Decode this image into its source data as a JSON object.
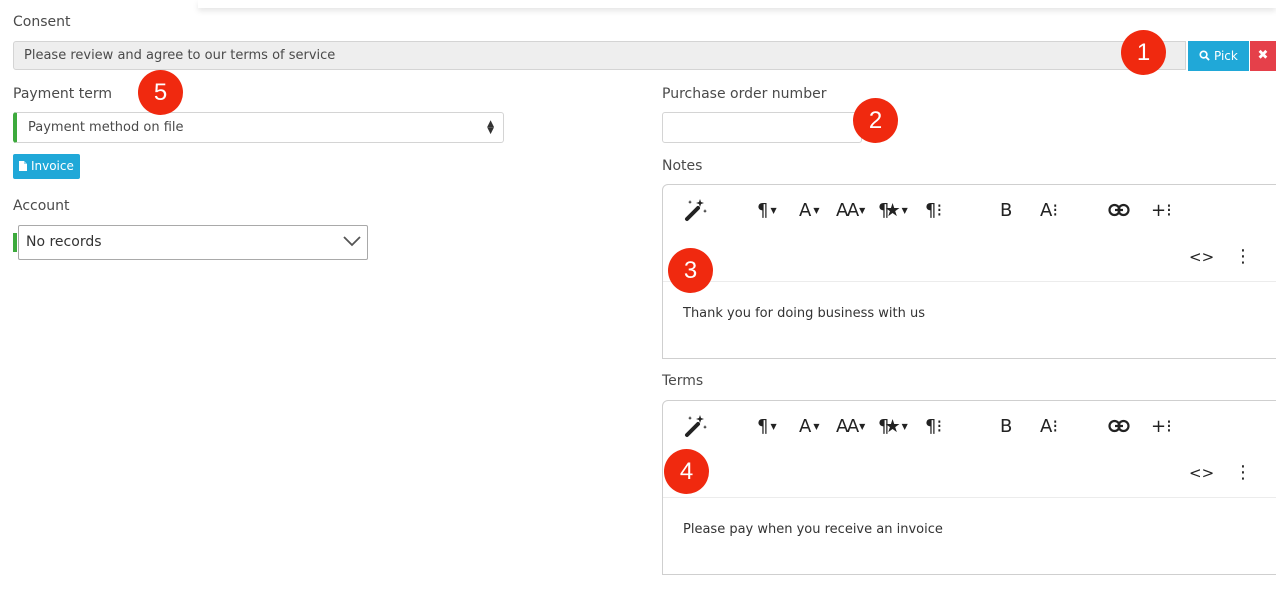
{
  "consent": {
    "label": "Consent",
    "value": "Please review and agree to our terms of service",
    "pick_label": "Pick",
    "clear_label": "✖"
  },
  "payment_term": {
    "label": "Payment term",
    "value": "Payment method on file",
    "invoice_label": "Invoice"
  },
  "account": {
    "label": "Account",
    "value": "No records"
  },
  "purchase_order": {
    "label": "Purchase order number",
    "value": ""
  },
  "notes": {
    "label": "Notes",
    "content": "Thank you for doing business with us"
  },
  "terms": {
    "label": "Terms",
    "content": "Please pay when you receive an invoice"
  },
  "annotations": [
    "1",
    "2",
    "3",
    "4",
    "5"
  ],
  "toolbar": {
    "paragraph_format": "¶",
    "font_family": "A",
    "font_size": "AA",
    "paragraph_style": "¶★",
    "more_paragraph": "¶⁝",
    "bold": "B",
    "more_text": "A⁝",
    "insert_link": "link-icon",
    "more_insert": "+⁝",
    "code_view": "<>",
    "more_menu": "⋮",
    "magic": "magic-wand-icon"
  },
  "colors": {
    "accent_blue": "#20a8d8",
    "danger_red": "#e5404a",
    "badge_red": "#f0290f",
    "required_green": "#3daa3d"
  }
}
